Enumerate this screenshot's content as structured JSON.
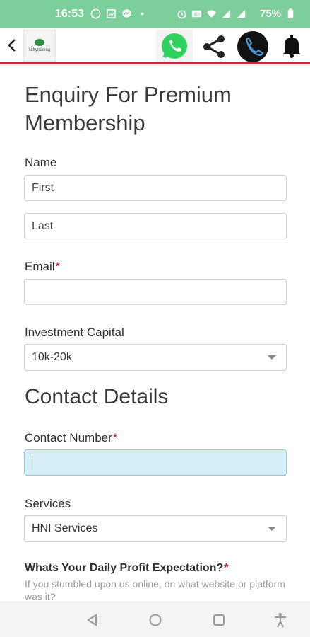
{
  "status_bar": {
    "time": "16:53",
    "battery": "75%",
    "background": "#7ccf9a",
    "icons": [
      "whatsapp-icon",
      "image-icon",
      "messenger-icon",
      "dot-icon",
      "alarm-icon",
      "data-icon",
      "wifi-icon",
      "signal-icon",
      "signal-icon",
      "battery-icon"
    ]
  },
  "app_bar": {
    "accent": "#c4263b",
    "logo_text": "Niftytrading"
  },
  "form": {
    "title": "Enquiry For Premium Membership",
    "name_label": "Name",
    "first_placeholder": "First",
    "last_placeholder": "Last",
    "email_label": "Email",
    "required_mark": "*",
    "investment_label": "Investment Capital",
    "investment_value": "10k-20k",
    "contact_section": "Contact Details",
    "contact_label": "Contact Number",
    "services_label": "Services",
    "services_value": "HNI Services",
    "question": "Whats Your Daily Profit Expectation?",
    "hint": "If you stumbled upon us online, on what website or platform was it?"
  },
  "nav_bar": {
    "items": [
      "back-triangle-icon",
      "home-circle-icon",
      "recents-square-icon",
      "accessibility-icon"
    ]
  }
}
